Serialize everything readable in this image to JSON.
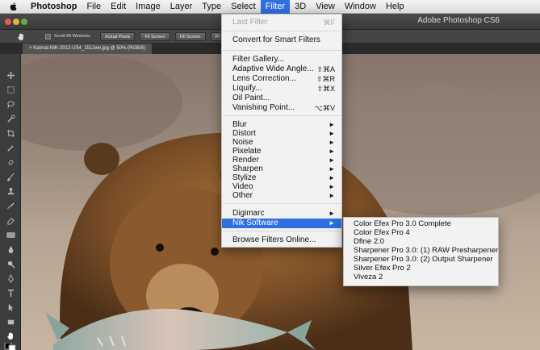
{
  "menubar": {
    "apple_icon": "apple-icon",
    "items": [
      "Photoshop",
      "File",
      "Edit",
      "Image",
      "Layer",
      "Type",
      "Select",
      "Filter",
      "3D",
      "View",
      "Window",
      "Help"
    ],
    "active_item": "Filter"
  },
  "window": {
    "title": "Adobe Photoshop CS6"
  },
  "options_bar": {
    "tool_icon": "hand-icon",
    "scroll_all_windows": "Scroll All Windows",
    "buttons": [
      "Actual Pixels",
      "Fit Screen",
      "Fill Screen",
      "Pr"
    ]
  },
  "document_tab": {
    "close_glyph": "×",
    "label": "Katmai-NIK-2012-US4_1512wn.jpg @ 50% (RGB/8)"
  },
  "filter_menu": {
    "last_filter": {
      "label": "Last Filter",
      "shortcut": "⌘F"
    },
    "convert": "Convert for Smart Filters",
    "filter_gallery": "Filter Gallery...",
    "adaptive_wide_angle": {
      "label": "Adaptive Wide Angle...",
      "shortcut": "⇧⌘A"
    },
    "lens_correction": {
      "label": "Lens Correction...",
      "shortcut": "⇧⌘R"
    },
    "liquify": {
      "label": "Liquify...",
      "shortcut": "⇧⌘X"
    },
    "oil_paint": "Oil Paint...",
    "vanishing_point": {
      "label": "Vanishing Point...",
      "shortcut": "⌥⌘V"
    },
    "categories": [
      "Blur",
      "Distort",
      "Noise",
      "Pixelate",
      "Render",
      "Sharpen",
      "Stylize",
      "Video",
      "Other"
    ],
    "digimarc": "Digimarc",
    "nik_software": "Nik Software",
    "browse": "Browse Filters Online...",
    "submenu_arrow": "►"
  },
  "nik_submenu": {
    "items": [
      "Color Efex Pro 3.0 Complete",
      "Color Efex Pro 4",
      "Dfine 2.0",
      "Sharpener Pro 3.0: (1) RAW Presharpener",
      "Sharpener Pro 3.0: (2) Output Sharpener",
      "Silver Efex Pro 2",
      "Viveza 2"
    ]
  },
  "colors": {
    "menu_highlight": "#2f6fe0",
    "menu_bg": "#f2f2f2",
    "app_chrome": "#3a3a3a"
  }
}
